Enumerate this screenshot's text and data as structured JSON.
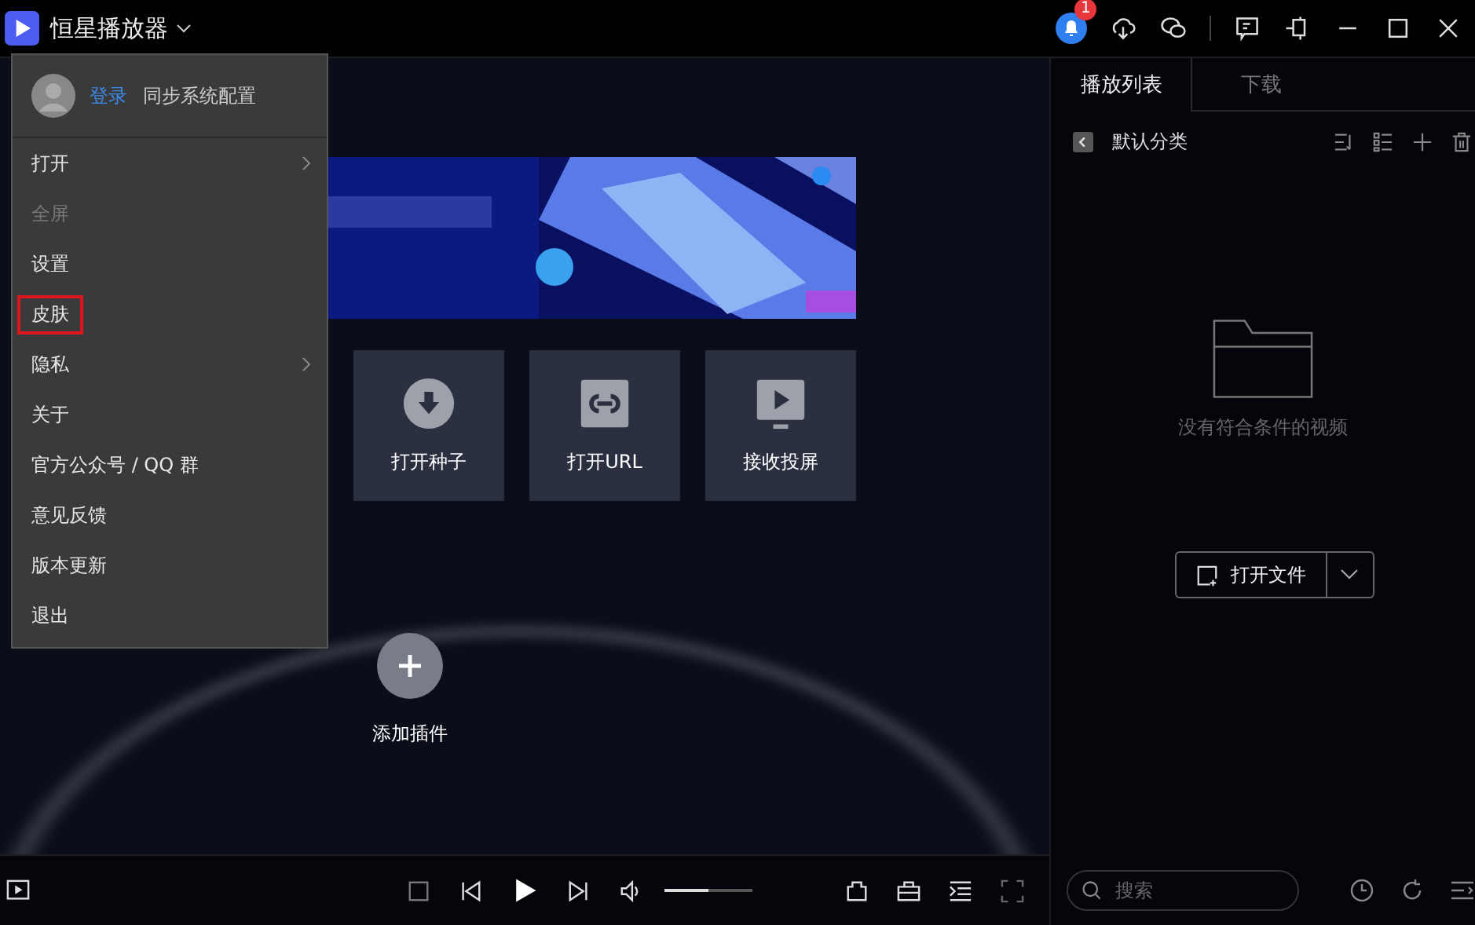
{
  "app": {
    "title": "恒星播放器",
    "notification_count": "1"
  },
  "menu": {
    "login": "登录",
    "sync": "同步系统配置",
    "items": [
      {
        "label": "打开",
        "disabled": false,
        "submenu": true,
        "highlighted": false
      },
      {
        "label": "全屏",
        "disabled": true,
        "submenu": false,
        "highlighted": false
      },
      {
        "label": "设置",
        "disabled": false,
        "submenu": false,
        "highlighted": false
      },
      {
        "label": "皮肤",
        "disabled": false,
        "submenu": false,
        "highlighted": true
      },
      {
        "label": "隐私",
        "disabled": false,
        "submenu": true,
        "highlighted": false
      },
      {
        "label": "关于",
        "disabled": false,
        "submenu": false,
        "highlighted": false
      },
      {
        "label": "官方公众号 / QQ 群",
        "disabled": false,
        "submenu": false,
        "highlighted": false
      },
      {
        "label": "意见反馈",
        "disabled": false,
        "submenu": false,
        "highlighted": false
      },
      {
        "label": "版本更新",
        "disabled": false,
        "submenu": false,
        "highlighted": false
      },
      {
        "label": "退出",
        "disabled": false,
        "submenu": false,
        "highlighted": false
      }
    ]
  },
  "tiles": [
    {
      "label": "打开种子",
      "kind": "torrent"
    },
    {
      "label": "打开URL",
      "kind": "url"
    },
    {
      "label": "接收投屏",
      "kind": "cast"
    }
  ],
  "add_plugin": {
    "label": "添加插件"
  },
  "player": {
    "volume": {
      "level": 0.5
    }
  },
  "playlist": {
    "tabs": [
      {
        "label": "播放列表",
        "selected": true
      },
      {
        "label": "下载",
        "selected": false
      }
    ],
    "category": "默认分类",
    "empty_text": "没有符合条件的视频",
    "open_button": "打开文件",
    "search": {
      "placeholder": "搜索"
    }
  }
}
